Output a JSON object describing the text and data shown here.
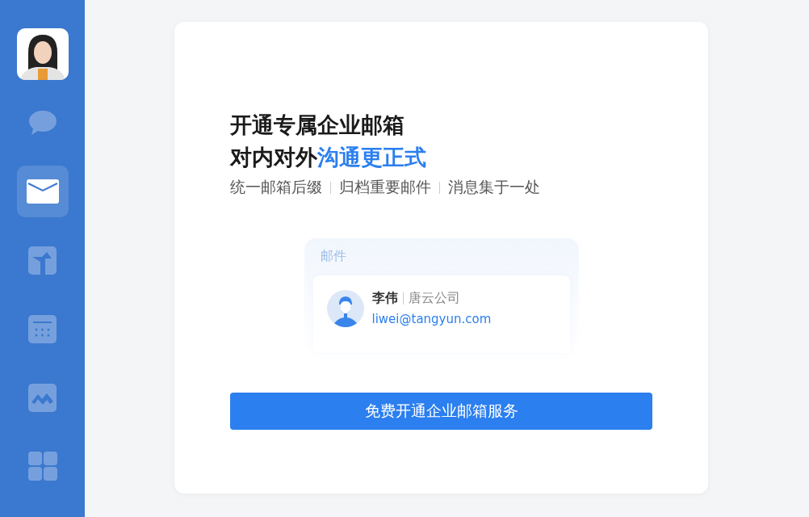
{
  "sidebar": {
    "items": [
      {
        "kind": "avatar"
      },
      {
        "kind": "chat",
        "selected": false
      },
      {
        "kind": "mail",
        "selected": true
      },
      {
        "kind": "shortcut",
        "selected": false
      },
      {
        "kind": "calendar",
        "selected": false
      },
      {
        "kind": "docs",
        "selected": false
      },
      {
        "kind": "apps",
        "selected": false
      }
    ]
  },
  "promo": {
    "title": "开通专属企业邮箱",
    "subtitle_lead": "对内对外",
    "subtitle_highlight": "沟通更正式",
    "features": [
      "统一邮箱后缀",
      "归档重要邮件",
      "消息集于一处"
    ],
    "preview": {
      "header": "邮件",
      "name": "李伟",
      "company": "唐云公司",
      "email": "liwei@tangyun.com"
    },
    "button": "免费开通企业邮箱服务"
  }
}
